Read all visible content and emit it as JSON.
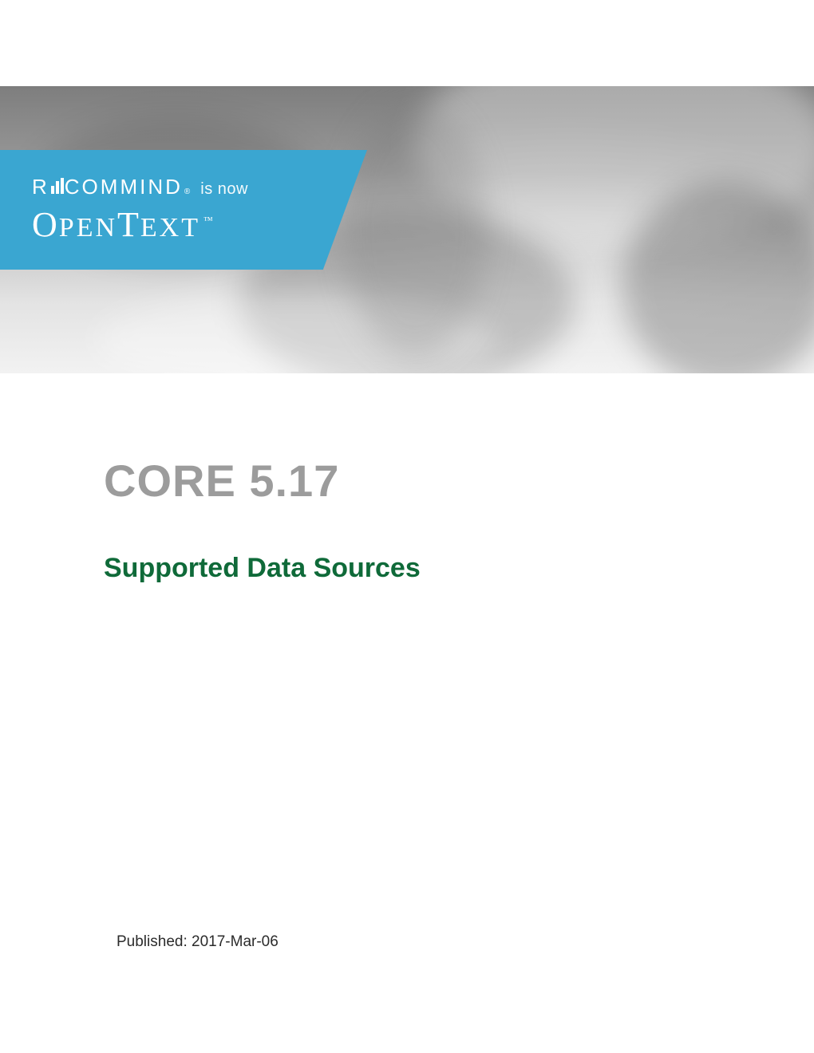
{
  "banner": {
    "brand_from": "RECOMMIND",
    "brand_from_reg": "®",
    "transition_text": "is now",
    "brand_to_part1": "O",
    "brand_to_part2": "PEN",
    "brand_to_part3": "T",
    "brand_to_part4": "EXT",
    "brand_to_tm": "™"
  },
  "document": {
    "title": "CORE 5.17",
    "subtitle": "Supported Data Sources",
    "published_label": "Published:",
    "published_date": "2017-Mar-06"
  }
}
